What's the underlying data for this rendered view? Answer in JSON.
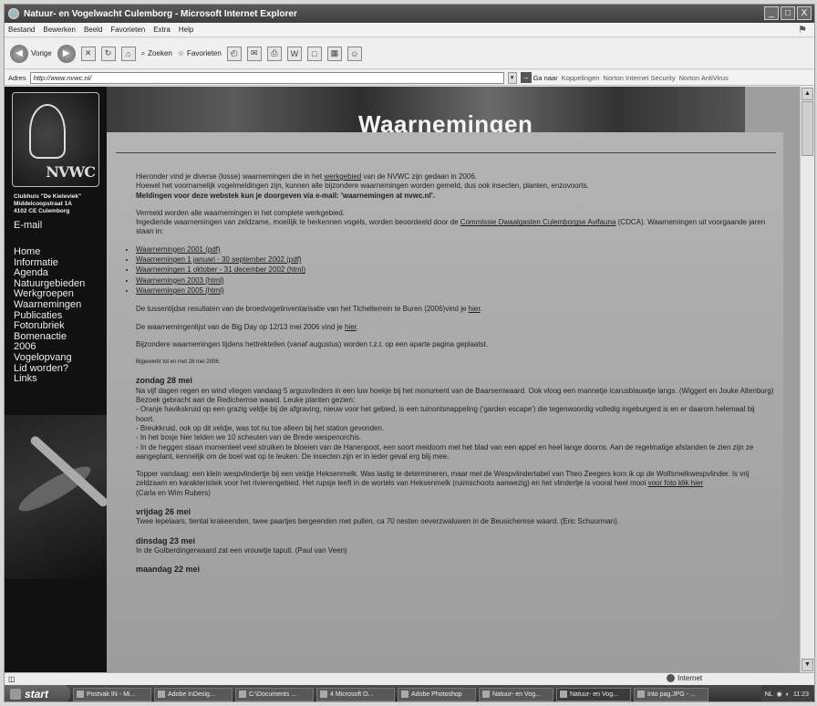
{
  "window": {
    "title": "Natuur- en Vogelwacht Culemborg - Microsoft Internet Explorer",
    "buttons": [
      "_",
      "□",
      "X"
    ]
  },
  "menu": [
    "Bestand",
    "Bewerken",
    "Beeld",
    "Favorieten",
    "Extra",
    "Help"
  ],
  "toolbar": {
    "back_label": "Vorige",
    "search_label": "Zoeken",
    "favorites_label": "Favorieten"
  },
  "address": {
    "label": "Adres",
    "url": "http://www.nvwc.nl/",
    "go_label": "Ga naar",
    "links_label": "Koppelingen",
    "norton_security": "Norton Internet Security",
    "norton_antivirus": "Norton AntiVirus"
  },
  "sidebar": {
    "address_lines": [
      "Clubhuis \"De Kieleviek\"",
      "Middelcoopstraat 1A",
      "4102 CE Culemborg"
    ],
    "email_label": "E-mail",
    "items": [
      "Home",
      "Informatie",
      "Agenda",
      "Natuurgebieden",
      "Werkgroepen",
      "Waarnemingen",
      "Publicaties",
      "Fotorubriek",
      "Bomenactie",
      "2006",
      "Vogelopvang",
      "Lid worden?",
      "Links"
    ],
    "logo_text": "NVWC"
  },
  "page": {
    "heading": "Waarnemingen",
    "intro1_before": "Hieronder vind je diverse (losse) waarnemingen die in het ",
    "intro1_link": "werkgebied",
    "intro1_after": " van de NVWC zijn gedaan in 2006.",
    "intro2": "Hoewel het voornamelijk vogelmeldingen zijn, kunnen alle bijzondere waarnemingen worden gemeld, dus ook insecten, planten, enzovoorts.",
    "intro3": "Meldingen voor deze webstek kun je doorgeven via e-mail: 'waarnemingen at nvwc.nl'.",
    "para2_line1": "Vermeld worden alle waarnemingen in het complete werkgebied.",
    "para2_line2_before": "Ingediende waarnemingen van zeldzame, moeilijk te herkennen vogels, worden beoordeeld door de ",
    "para2_link": "Commissie Dwaalgasten Culemborgse Avifauna",
    "para2_line2_after": " (CDCA). Waarnemingen uit voorgaande jaren staan in:",
    "archive_links": [
      "Waarnemingen 2001 (pdf)",
      "Waarnemingen 1 januari - 30 september 2002 (pdf)",
      "Waarnemingen 1 oktober - 31 december 2002 (html)",
      "Waarnemingen 2003 (html)",
      "Waarnemingen 2005 (html)"
    ],
    "broed_before": "De tussentijdse resultaten van de broedvogelinventarisatie van het Tichelterrein te Buren (2006)vind je ",
    "broed_link": "hier",
    "broed_after": ".",
    "bigday_before": "De waarnemingenlijst van de Big Day op 12/13 mei 2006 vind je ",
    "bigday_link": "hier",
    "bigday_after": ".",
    "trek": "Bijzondere waarnemingen tijdens hettrektellen (vanaf augustus) worden t.z.t. op een aparte pagina geplaatst.",
    "updated": "Bijgewerkt tot en met 28 mei 2006.",
    "day1_title": "zondag 28 mei",
    "day1_p1": "Na vijf dagen regen en wind vliegen vandaag 5 argusvlinders in een luw hoekje bij het monument van de Baarsemwaard. Ook vloog een mannetje icarusblauwtje langs. (Wiggert en Jouke Altenburg)",
    "day1_p2": "Bezoek gebracht aan de Redichemse waard. Leuke planten gezien:",
    "day1_p3": "- Oranje havikskruid op een grazig veldje bij de afgraving, nieuw voor het gebied, is een tuinontsnappeling ('garden escape') die tegenwoordig volledig ingeburgerd is en er daarom helemaal bij hoort.",
    "day1_p4": "- Breukkruid, ook op dit veldje, was tot nu toe alleen bij het station gevonden.",
    "day1_p5": "- In het bosje hier telden we 10 scheuten van de Brede wespenorchis.",
    "day1_p6": "- In de heggen staan momenteel veel struiken te bloeien van de Hanenpoot, een soort meidoorn met het blad van een appel en heel lange doorns. Aan de regelmatige afstanden te zien zijn ze aangeplant, kennelijk om de boel wat op te leuken. De insecten zijn er in ieder geval erg blij mee.",
    "day1_p7_before": "Topper vandaag: een klein wespvlindertje bij een veldje Heksenmelk. Was lastig te determineren, maar met de Wespvlindertabel van Theo Zeegers kom ik op de Wolfsmelkwespvlinder. Is vrij zeldzaam en karakteristiek voor het rivierengebied. Het rupsje leeft in de wortels van Heksenmelk (ruimschoots aanwezig) en het vlindertje is vooral heel mooi ",
    "day1_p7_link": "voor foto klik hier",
    "day1_p7_after": "",
    "day1_p7_author": "(Carla en Wim Rubers)",
    "day2_title": "vrijdag 26 mei",
    "day2_p1": "Twee lepelaars, tiental krakeenden, twee paartjes bergeenden met pullen, ca 70 nesten oeverzwaluwen in de Beusichemse waard. (Eric Schuurman).",
    "day3_title": "dinsdag 23 mei",
    "day3_p1": "In de Golberdingerwaard zat een vrouwtje tapuit. (Paul van Veen)",
    "day4_title": "maandag 22 mei"
  },
  "status": {
    "zone": "Internet"
  },
  "taskbar": {
    "start": "start",
    "tasks": [
      "Postvak IN - Mi...",
      "Adobe InDesig...",
      "C:\\Documents ...",
      "4 Microsoft O...",
      "Adobe Photoshop",
      "Natuur- en Vog...",
      "Natuur- en Vog...",
      "Into pag.JPG - ..."
    ],
    "lang": "NL",
    "clock": "11:23"
  }
}
